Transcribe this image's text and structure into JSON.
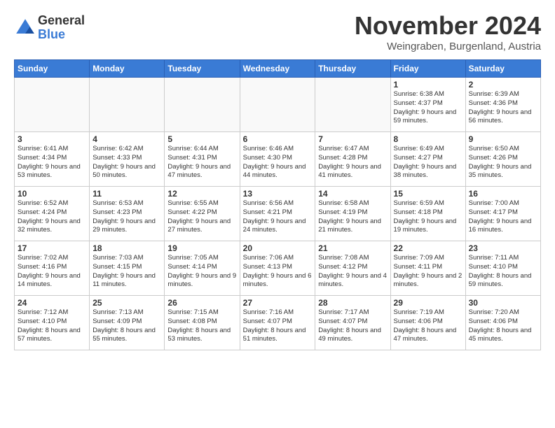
{
  "logo": {
    "general": "General",
    "blue": "Blue"
  },
  "title": "November 2024",
  "location": "Weingraben, Burgenland, Austria",
  "headers": [
    "Sunday",
    "Monday",
    "Tuesday",
    "Wednesday",
    "Thursday",
    "Friday",
    "Saturday"
  ],
  "weeks": [
    [
      {
        "day": "",
        "info": ""
      },
      {
        "day": "",
        "info": ""
      },
      {
        "day": "",
        "info": ""
      },
      {
        "day": "",
        "info": ""
      },
      {
        "day": "",
        "info": ""
      },
      {
        "day": "1",
        "info": "Sunrise: 6:38 AM\nSunset: 4:37 PM\nDaylight: 9 hours and 59 minutes."
      },
      {
        "day": "2",
        "info": "Sunrise: 6:39 AM\nSunset: 4:36 PM\nDaylight: 9 hours and 56 minutes."
      }
    ],
    [
      {
        "day": "3",
        "info": "Sunrise: 6:41 AM\nSunset: 4:34 PM\nDaylight: 9 hours and 53 minutes."
      },
      {
        "day": "4",
        "info": "Sunrise: 6:42 AM\nSunset: 4:33 PM\nDaylight: 9 hours and 50 minutes."
      },
      {
        "day": "5",
        "info": "Sunrise: 6:44 AM\nSunset: 4:31 PM\nDaylight: 9 hours and 47 minutes."
      },
      {
        "day": "6",
        "info": "Sunrise: 6:46 AM\nSunset: 4:30 PM\nDaylight: 9 hours and 44 minutes."
      },
      {
        "day": "7",
        "info": "Sunrise: 6:47 AM\nSunset: 4:28 PM\nDaylight: 9 hours and 41 minutes."
      },
      {
        "day": "8",
        "info": "Sunrise: 6:49 AM\nSunset: 4:27 PM\nDaylight: 9 hours and 38 minutes."
      },
      {
        "day": "9",
        "info": "Sunrise: 6:50 AM\nSunset: 4:26 PM\nDaylight: 9 hours and 35 minutes."
      }
    ],
    [
      {
        "day": "10",
        "info": "Sunrise: 6:52 AM\nSunset: 4:24 PM\nDaylight: 9 hours and 32 minutes."
      },
      {
        "day": "11",
        "info": "Sunrise: 6:53 AM\nSunset: 4:23 PM\nDaylight: 9 hours and 29 minutes."
      },
      {
        "day": "12",
        "info": "Sunrise: 6:55 AM\nSunset: 4:22 PM\nDaylight: 9 hours and 27 minutes."
      },
      {
        "day": "13",
        "info": "Sunrise: 6:56 AM\nSunset: 4:21 PM\nDaylight: 9 hours and 24 minutes."
      },
      {
        "day": "14",
        "info": "Sunrise: 6:58 AM\nSunset: 4:19 PM\nDaylight: 9 hours and 21 minutes."
      },
      {
        "day": "15",
        "info": "Sunrise: 6:59 AM\nSunset: 4:18 PM\nDaylight: 9 hours and 19 minutes."
      },
      {
        "day": "16",
        "info": "Sunrise: 7:00 AM\nSunset: 4:17 PM\nDaylight: 9 hours and 16 minutes."
      }
    ],
    [
      {
        "day": "17",
        "info": "Sunrise: 7:02 AM\nSunset: 4:16 PM\nDaylight: 9 hours and 14 minutes."
      },
      {
        "day": "18",
        "info": "Sunrise: 7:03 AM\nSunset: 4:15 PM\nDaylight: 9 hours and 11 minutes."
      },
      {
        "day": "19",
        "info": "Sunrise: 7:05 AM\nSunset: 4:14 PM\nDaylight: 9 hours and 9 minutes."
      },
      {
        "day": "20",
        "info": "Sunrise: 7:06 AM\nSunset: 4:13 PM\nDaylight: 9 hours and 6 minutes."
      },
      {
        "day": "21",
        "info": "Sunrise: 7:08 AM\nSunset: 4:12 PM\nDaylight: 9 hours and 4 minutes."
      },
      {
        "day": "22",
        "info": "Sunrise: 7:09 AM\nSunset: 4:11 PM\nDaylight: 9 hours and 2 minutes."
      },
      {
        "day": "23",
        "info": "Sunrise: 7:11 AM\nSunset: 4:10 PM\nDaylight: 8 hours and 59 minutes."
      }
    ],
    [
      {
        "day": "24",
        "info": "Sunrise: 7:12 AM\nSunset: 4:10 PM\nDaylight: 8 hours and 57 minutes."
      },
      {
        "day": "25",
        "info": "Sunrise: 7:13 AM\nSunset: 4:09 PM\nDaylight: 8 hours and 55 minutes."
      },
      {
        "day": "26",
        "info": "Sunrise: 7:15 AM\nSunset: 4:08 PM\nDaylight: 8 hours and 53 minutes."
      },
      {
        "day": "27",
        "info": "Sunrise: 7:16 AM\nSunset: 4:07 PM\nDaylight: 8 hours and 51 minutes."
      },
      {
        "day": "28",
        "info": "Sunrise: 7:17 AM\nSunset: 4:07 PM\nDaylight: 8 hours and 49 minutes."
      },
      {
        "day": "29",
        "info": "Sunrise: 7:19 AM\nSunset: 4:06 PM\nDaylight: 8 hours and 47 minutes."
      },
      {
        "day": "30",
        "info": "Sunrise: 7:20 AM\nSunset: 4:06 PM\nDaylight: 8 hours and 45 minutes."
      }
    ]
  ]
}
